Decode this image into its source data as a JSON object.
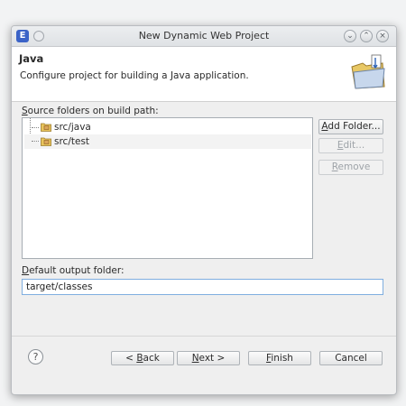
{
  "window": {
    "title": "New Dynamic Web Project"
  },
  "header": {
    "title": "Java",
    "description": "Configure project for building a Java application."
  },
  "source_section": {
    "label_mnemonic": "S",
    "label_rest": "ource folders on build path:",
    "folders": [
      "src/java",
      "src/test"
    ]
  },
  "side_buttons": [
    {
      "mnemonic": "A",
      "rest": "dd Folder...",
      "enabled": true
    },
    {
      "mnemonic": "E",
      "rest": "dit...",
      "enabled": false
    },
    {
      "mnemonic": "R",
      "rest": "emove",
      "enabled": false
    }
  ],
  "output_section": {
    "label_mnemonic": "D",
    "label_rest": "efault output folder:",
    "value": "target/classes"
  },
  "footer": {
    "help_glyph": "?",
    "back": {
      "pre": "< ",
      "mnemonic": "B",
      "rest": "ack"
    },
    "next": {
      "mnemonic": "N",
      "rest": "ext >"
    },
    "finish": {
      "mnemonic": "F",
      "rest": "inish"
    },
    "cancel": "Cancel"
  },
  "colors": {
    "focus_border": "#7faee0",
    "app_icon": "#3b63c7",
    "disabled_text": "#9ea3a8"
  }
}
